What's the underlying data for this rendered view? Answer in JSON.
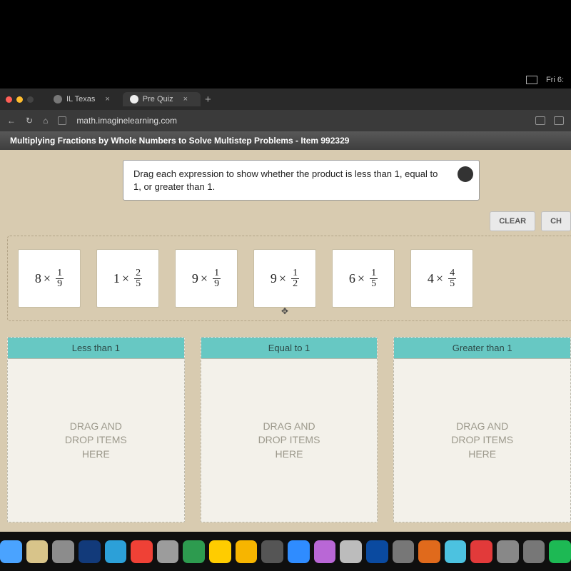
{
  "menubar": {
    "time": "Fri 6:"
  },
  "tabs": [
    {
      "label": "IL Texas",
      "close": "×"
    },
    {
      "label": "Pre Quiz",
      "close": "×"
    }
  ],
  "newtab": "+",
  "addr": {
    "back": "←",
    "reload": "↻",
    "home": "⌂",
    "url": "math.imaginelearning.com"
  },
  "lesson_title": "Multiplying Fractions by Whole Numbers to Solve Multistep Problems - Item 992329",
  "instruction": "Drag each expression to show whether the product is less than 1, equal to 1, or greater than 1.",
  "buttons": {
    "clear": "CLEAR",
    "check": "CH"
  },
  "expressions": [
    {
      "whole": "8",
      "num": "1",
      "den": "9"
    },
    {
      "whole": "1",
      "num": "2",
      "den": "5"
    },
    {
      "whole": "9",
      "num": "1",
      "den": "9"
    },
    {
      "whole": "9",
      "num": "1",
      "den": "2",
      "cursor": true
    },
    {
      "whole": "6",
      "num": "1",
      "den": "5"
    },
    {
      "whole": "4",
      "num": "4",
      "den": "5"
    }
  ],
  "mult": "×",
  "move_glyph": "✥",
  "zones": [
    {
      "label": "Less than 1"
    },
    {
      "label": "Equal to 1"
    },
    {
      "label": "Greater than 1"
    }
  ],
  "zone_placeholder": "DRAG AND\nDROP ITEMS\nHERE",
  "dock_colors": [
    "#4aa3ff",
    "#d8c48a",
    "#8c8c8c",
    "#123a7a",
    "#2ca0d8",
    "#ef4136",
    "#9c9c9c",
    "#2d9b4f",
    "#ffcc00",
    "#f7b500",
    "#555",
    "#2f8cff",
    "#b967d6",
    "#bcbcbc",
    "#0a4aa0",
    "#777",
    "#e06a1c",
    "#4cc2e0",
    "#e23a3a",
    "#888",
    "#777",
    "#1db954"
  ]
}
